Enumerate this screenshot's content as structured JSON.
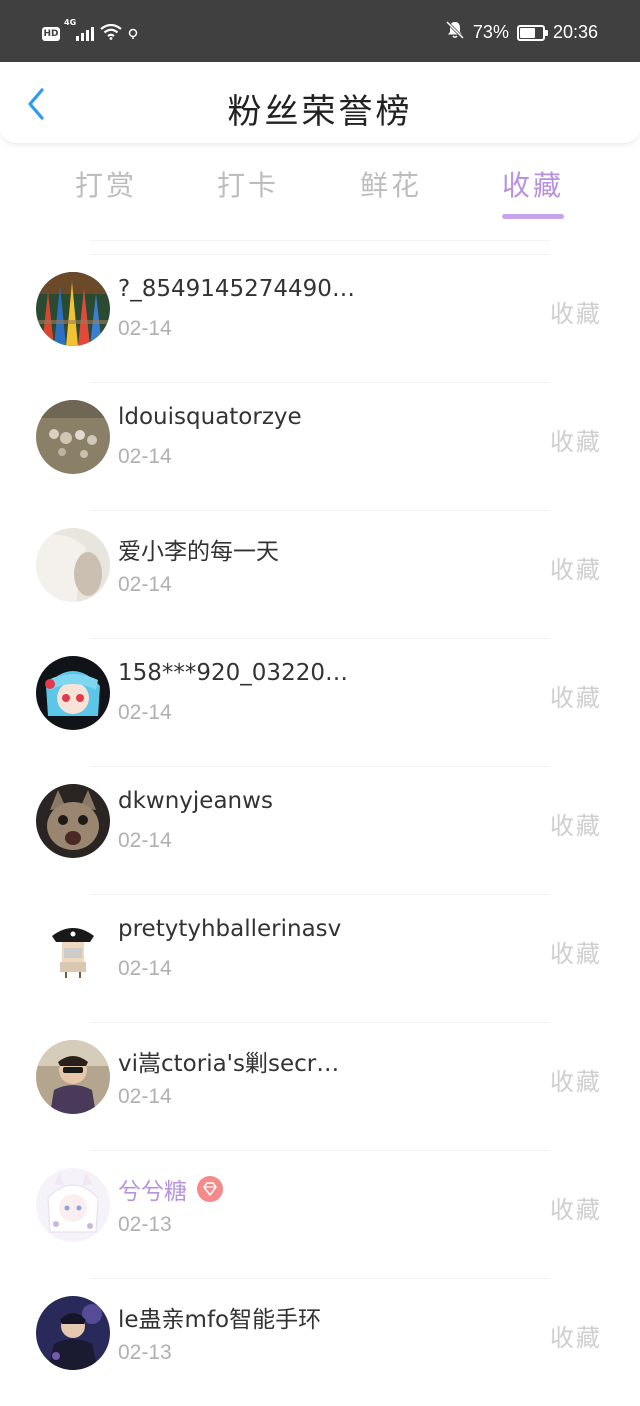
{
  "status_bar": {
    "hd": "HD",
    "network": "4G",
    "battery": "73%",
    "battery_level": 0.73,
    "time": "20:36"
  },
  "header": {
    "title": "粉丝荣誉榜",
    "back_icon": "chevron-left-icon"
  },
  "tabs": [
    {
      "label": "打赏",
      "active": false
    },
    {
      "label": "打卡",
      "active": false
    },
    {
      "label": "鲜花",
      "active": false
    },
    {
      "label": "收藏",
      "active": true
    }
  ],
  "colors": {
    "accent": "#b792de",
    "indicator": "#c7a3ec",
    "back_arrow": "#2d9cf0",
    "status_bar": "#404040",
    "vip_badge": "#f58a8a"
  },
  "fans": [
    {
      "name": "?_8549145274490…",
      "date": "02-14",
      "action": "收藏",
      "vip": false
    },
    {
      "name": "ldouisquatorzye",
      "date": "02-14",
      "action": "收藏",
      "vip": false
    },
    {
      "name": "爱小李的每一天",
      "date": "02-14",
      "action": "收藏",
      "vip": false
    },
    {
      "name": "158***920_03220…",
      "date": "02-14",
      "action": "收藏",
      "vip": false
    },
    {
      "name": "dkwnyjeanws",
      "date": "02-14",
      "action": "收藏",
      "vip": false
    },
    {
      "name": "pretytyhballerinasv",
      "date": "02-14",
      "action": "收藏",
      "vip": false
    },
    {
      "name": "vi嵩ctoria's剿secr…",
      "date": "02-14",
      "action": "收藏",
      "vip": false
    },
    {
      "name": "兮兮糖",
      "date": "02-13",
      "action": "收藏",
      "vip": true
    },
    {
      "name": "le蛊亲mfo智能手环",
      "date": "02-13",
      "action": "收藏",
      "vip": false
    }
  ]
}
